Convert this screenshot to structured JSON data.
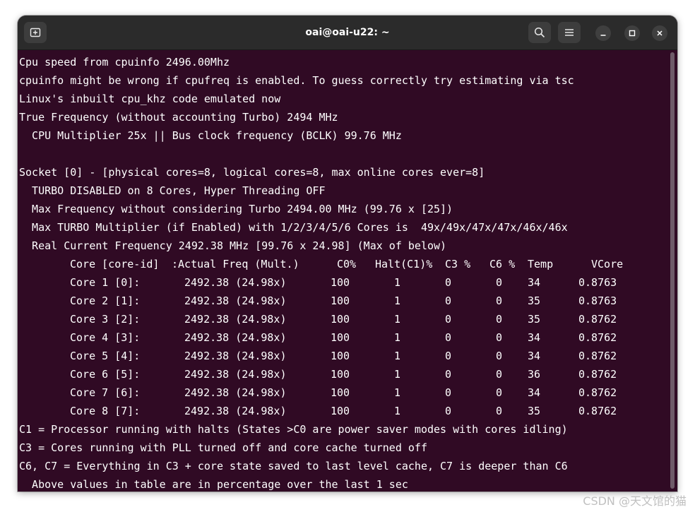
{
  "window": {
    "title": "oai@oai-u22: ~"
  },
  "icons": {
    "new_tab": "new-tab-icon",
    "search": "search-icon",
    "menu": "hamburger-menu-icon",
    "minimize": "minimize-icon",
    "maximize": "maximize-icon",
    "close": "close-icon"
  },
  "colors": {
    "terminal_bg": "#300a24",
    "titlebar_bg": "#2b2b2b",
    "text": "#ffffff"
  },
  "terminal": {
    "lines_top": [
      "Cpu speed from cpuinfo 2496.00Mhz",
      "cpuinfo might be wrong if cpufreq is enabled. To guess correctly try estimating via tsc",
      "Linux's inbuilt cpu_khz code emulated now",
      "True Frequency (without accounting Turbo) 2494 MHz",
      "  CPU Multiplier 25x || Bus clock frequency (BCLK) 99.76 MHz",
      "",
      "Socket [0] - [physical cores=8, logical cores=8, max online cores ever=8]",
      "  TURBO DISABLED on 8 Cores, Hyper Threading OFF",
      "  Max Frequency without considering Turbo 2494.00 MHz (99.76 x [25])",
      "  Max TURBO Multiplier (if Enabled) with 1/2/3/4/5/6 Cores is  49x/49x/47x/47x/46x/46x",
      "  Real Current Frequency 2492.38 MHz [99.76 x 24.98] (Max of below)"
    ],
    "table_header": {
      "core": "Core [core-id]",
      "freq": ":Actual Freq (Mult.)",
      "c0": "C0%",
      "halt": "Halt(C1)%",
      "c3": "C3 %",
      "c6": "C6 %",
      "temp": "Temp",
      "vcore": "VCore"
    },
    "table_rows": [
      {
        "core": "Core 1 [0]:",
        "freq": "2492.38 (24.98x)",
        "c0": "100",
        "halt": "1",
        "c3": "0",
        "c6": "0",
        "temp": "34",
        "vcore": "0.8763"
      },
      {
        "core": "Core 2 [1]:",
        "freq": "2492.38 (24.98x)",
        "c0": "100",
        "halt": "1",
        "c3": "0",
        "c6": "0",
        "temp": "35",
        "vcore": "0.8763"
      },
      {
        "core": "Core 3 [2]:",
        "freq": "2492.38 (24.98x)",
        "c0": "100",
        "halt": "1",
        "c3": "0",
        "c6": "0",
        "temp": "35",
        "vcore": "0.8762"
      },
      {
        "core": "Core 4 [3]:",
        "freq": "2492.38 (24.98x)",
        "c0": "100",
        "halt": "1",
        "c3": "0",
        "c6": "0",
        "temp": "34",
        "vcore": "0.8762"
      },
      {
        "core": "Core 5 [4]:",
        "freq": "2492.38 (24.98x)",
        "c0": "100",
        "halt": "1",
        "c3": "0",
        "c6": "0",
        "temp": "34",
        "vcore": "0.8762"
      },
      {
        "core": "Core 6 [5]:",
        "freq": "2492.38 (24.98x)",
        "c0": "100",
        "halt": "1",
        "c3": "0",
        "c6": "0",
        "temp": "36",
        "vcore": "0.8762"
      },
      {
        "core": "Core 7 [6]:",
        "freq": "2492.38 (24.98x)",
        "c0": "100",
        "halt": "1",
        "c3": "0",
        "c6": "0",
        "temp": "34",
        "vcore": "0.8762"
      },
      {
        "core": "Core 8 [7]:",
        "freq": "2492.38 (24.98x)",
        "c0": "100",
        "halt": "1",
        "c3": "0",
        "c6": "0",
        "temp": "35",
        "vcore": "0.8762"
      }
    ],
    "lines_bottom": [
      "C1 = Processor running with halts (States >C0 are power saver modes with cores idling)",
      "C3 = Cores running with PLL turned off and core cache turned off",
      "C6, C7 = Everything in C3 + core state saved to last level cache, C7 is deeper than C6",
      "  Above values in table are in percentage over the last 1 sec"
    ]
  },
  "watermark": "CSDN @天文馆的猫"
}
